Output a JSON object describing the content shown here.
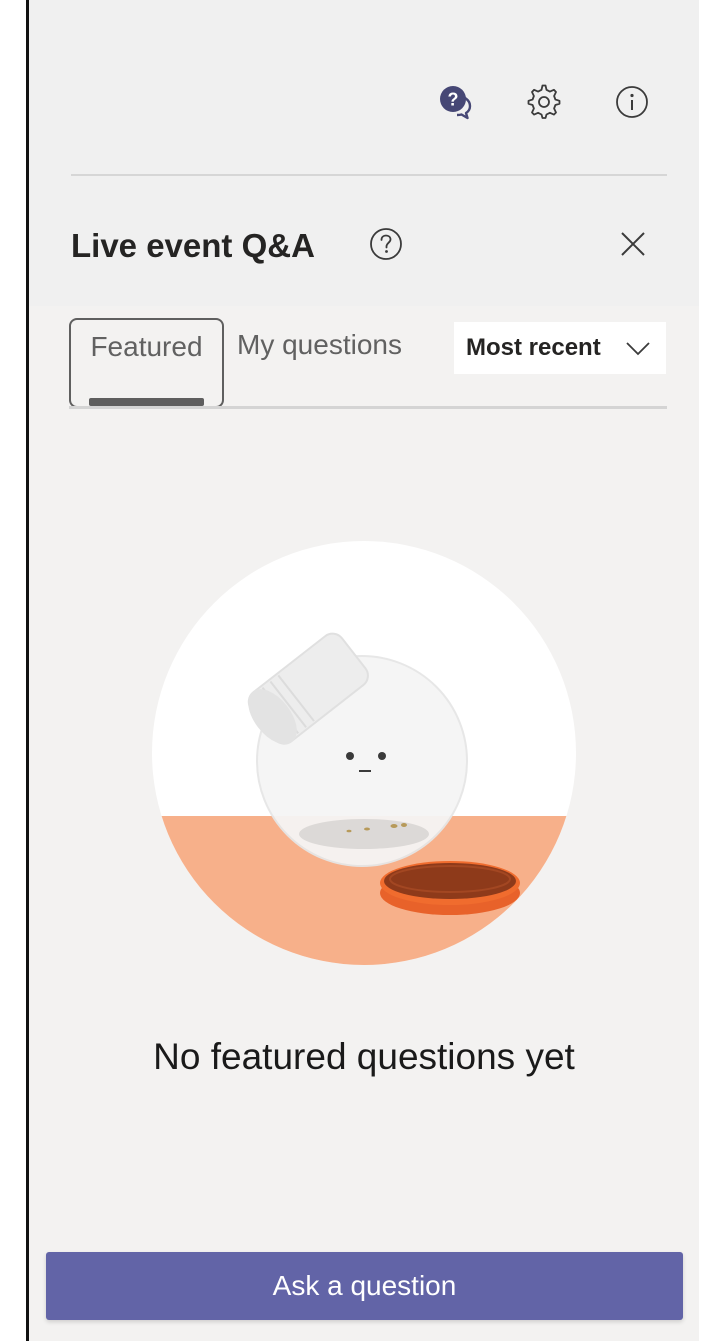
{
  "header": {
    "icons": [
      "qa-chat-icon",
      "gear-icon",
      "info-icon"
    ]
  },
  "panel": {
    "title": "Live event Q&A",
    "help_icon": "question-circle-icon",
    "close_icon": "close-icon"
  },
  "tabs": [
    {
      "label": "Featured",
      "selected": true
    },
    {
      "label": "My questions",
      "selected": false
    }
  ],
  "sort": {
    "selected": "Most recent",
    "icon": "chevron-down-icon"
  },
  "empty_state": {
    "message": "No featured questions yet",
    "illustration": "empty-jar-illustration"
  },
  "actions": {
    "ask_label": "Ask a question"
  },
  "colors": {
    "accent": "#6264a7",
    "qa_icon": "#464775",
    "background": "#f3f2f1",
    "illustration_orange": "#f7b08a",
    "lid_orange": "#e8622a"
  }
}
